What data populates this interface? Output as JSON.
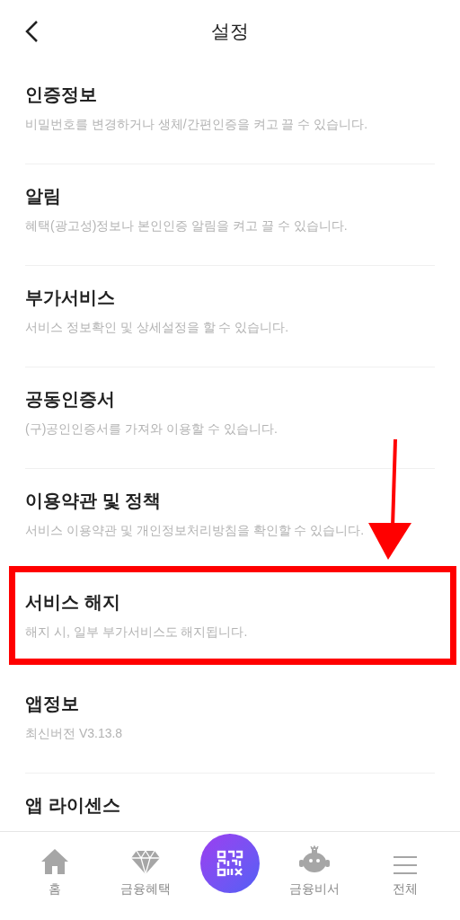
{
  "header": {
    "title": "설정"
  },
  "items": [
    {
      "title": "인증정보",
      "description": "비밀번호를 변경하거나 생체/간편인증을 켜고 끌 수 있습니다.",
      "highlighted": false
    },
    {
      "title": "알림",
      "description": "혜택(광고성)정보나 본인인증 알림을 켜고 끌 수 있습니다.",
      "highlighted": false
    },
    {
      "title": "부가서비스",
      "description": "서비스 정보확인 및 상세설정을 할 수 있습니다.",
      "highlighted": false
    },
    {
      "title": "공동인증서",
      "description": "(구)공인인증서를 가져와 이용할 수 있습니다.",
      "highlighted": false
    },
    {
      "title": "이용약관 및 정책",
      "description": "서비스 이용약관 및 개인정보처리방침을 확인할 수 있습니다.",
      "highlighted": false
    },
    {
      "title": "서비스 해지",
      "description": "해지 시, 일부 부가서비스도 해지됩니다.",
      "highlighted": true
    },
    {
      "title": "앱정보",
      "description": "최신버전 V3.13.8",
      "highlighted": false
    },
    {
      "title": "앱 라이센스",
      "highlighted": false
    }
  ],
  "bottom_nav": [
    {
      "kind": "home",
      "label": "홈"
    },
    {
      "kind": "diamond",
      "label": "금융혜택"
    },
    {
      "kind": "qr"
    },
    {
      "kind": "robot",
      "label": "금융비서"
    },
    {
      "kind": "menu",
      "label": "전체"
    }
  ]
}
